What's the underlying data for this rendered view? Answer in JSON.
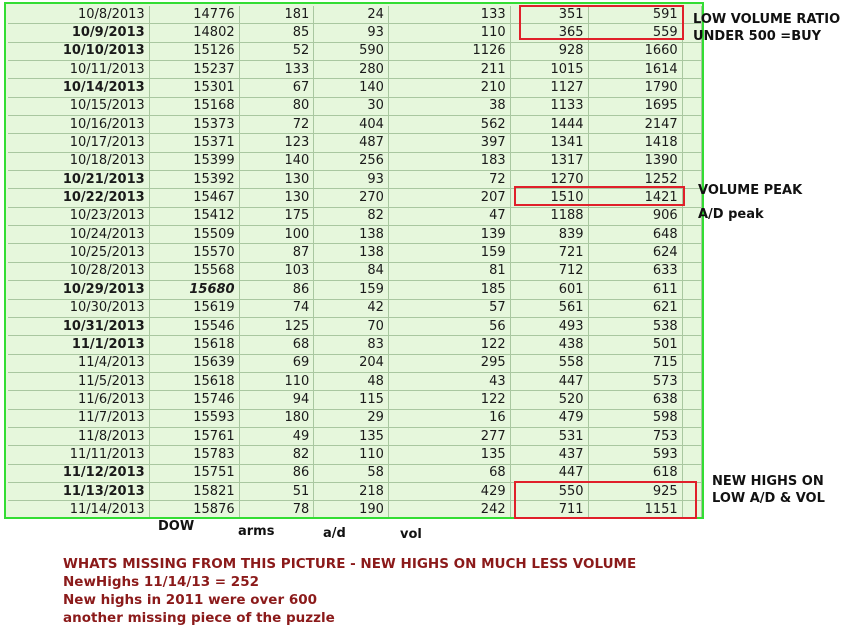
{
  "table": {
    "rows": [
      {
        "date": "10/8/2013",
        "dow": "14776",
        "arms": "181",
        "ad": "24",
        "vol": "133",
        "c6": "351",
        "c7": "591",
        "bold": false
      },
      {
        "date": "10/9/2013",
        "dow": "14802",
        "arms": "85",
        "ad": "93",
        "vol": "110",
        "c6": "365",
        "c7": "559",
        "bold": true
      },
      {
        "date": "10/10/2013",
        "dow": "15126",
        "arms": "52",
        "ad": "590",
        "vol": "1126",
        "c6": "928",
        "c7": "1660",
        "bold": true
      },
      {
        "date": "10/11/2013",
        "dow": "15237",
        "arms": "133",
        "ad": "280",
        "vol": "211",
        "c6": "1015",
        "c7": "1614",
        "bold": false
      },
      {
        "date": "10/14/2013",
        "dow": "15301",
        "arms": "67",
        "ad": "140",
        "vol": "210",
        "c6": "1127",
        "c7": "1790",
        "bold": true
      },
      {
        "date": "10/15/2013",
        "dow": "15168",
        "arms": "80",
        "ad": "30",
        "vol": "38",
        "c6": "1133",
        "c7": "1695",
        "bold": false
      },
      {
        "date": "10/16/2013",
        "dow": "15373",
        "arms": "72",
        "ad": "404",
        "vol": "562",
        "c6": "1444",
        "c7": "2147",
        "bold": false
      },
      {
        "date": "10/17/2013",
        "dow": "15371",
        "arms": "123",
        "ad": "487",
        "vol": "397",
        "c6": "1341",
        "c7": "1418",
        "bold": false
      },
      {
        "date": "10/18/2013",
        "dow": "15399",
        "arms": "140",
        "ad": "256",
        "vol": "183",
        "c6": "1317",
        "c7": "1390",
        "bold": false
      },
      {
        "date": "10/21/2013",
        "dow": "15392",
        "arms": "130",
        "ad": "93",
        "vol": "72",
        "c6": "1270",
        "c7": "1252",
        "bold": true
      },
      {
        "date": "10/22/2013",
        "dow": "15467",
        "arms": "130",
        "ad": "270",
        "vol": "207",
        "c6": "1510",
        "c7": "1421",
        "bold": true
      },
      {
        "date": "10/23/2013",
        "dow": "15412",
        "arms": "175",
        "ad": "82",
        "vol": "47",
        "c6": "1188",
        "c7": "906",
        "bold": false
      },
      {
        "date": "10/24/2013",
        "dow": "15509",
        "arms": "100",
        "ad": "138",
        "vol": "139",
        "c6": "839",
        "c7": "648",
        "bold": false
      },
      {
        "date": "10/25/2013",
        "dow": "15570",
        "arms": "87",
        "ad": "138",
        "vol": "159",
        "c6": "721",
        "c7": "624",
        "bold": false
      },
      {
        "date": "10/28/2013",
        "dow": "15568",
        "arms": "103",
        "ad": "84",
        "vol": "81",
        "c6": "712",
        "c7": "633",
        "bold": false
      },
      {
        "date": "10/29/2013",
        "dow": "15680",
        "arms": "86",
        "ad": "159",
        "vol": "185",
        "c6": "601",
        "c7": "611",
        "bold": true,
        "dow_italic": true
      },
      {
        "date": "10/30/2013",
        "dow": "15619",
        "arms": "74",
        "ad": "42",
        "vol": "57",
        "c6": "561",
        "c7": "621",
        "bold": false
      },
      {
        "date": "10/31/2013",
        "dow": "15546",
        "arms": "125",
        "ad": "70",
        "vol": "56",
        "c6": "493",
        "c7": "538",
        "bold": true
      },
      {
        "date": "11/1/2013",
        "dow": "15618",
        "arms": "68",
        "ad": "83",
        "vol": "122",
        "c6": "438",
        "c7": "501",
        "bold": true
      },
      {
        "date": "11/4/2013",
        "dow": "15639",
        "arms": "69",
        "ad": "204",
        "vol": "295",
        "c6": "558",
        "c7": "715",
        "bold": false
      },
      {
        "date": "11/5/2013",
        "dow": "15618",
        "arms": "110",
        "ad": "48",
        "vol": "43",
        "c6": "447",
        "c7": "573",
        "bold": false
      },
      {
        "date": "11/6/2013",
        "dow": "15746",
        "arms": "94",
        "ad": "115",
        "vol": "122",
        "c6": "520",
        "c7": "638",
        "bold": false
      },
      {
        "date": "11/7/2013",
        "dow": "15593",
        "arms": "180",
        "ad": "29",
        "vol": "16",
        "c6": "479",
        "c7": "598",
        "bold": false
      },
      {
        "date": "11/8/2013",
        "dow": "15761",
        "arms": "49",
        "ad": "135",
        "vol": "277",
        "c6": "531",
        "c7": "753",
        "bold": false
      },
      {
        "date": "11/11/2013",
        "dow": "15783",
        "arms": "82",
        "ad": "110",
        "vol": "135",
        "c6": "437",
        "c7": "593",
        "bold": false
      },
      {
        "date": "11/12/2013",
        "dow": "15751",
        "arms": "86",
        "ad": "58",
        "vol": "68",
        "c6": "447",
        "c7": "618",
        "bold": true
      },
      {
        "date": "11/13/2013",
        "dow": "15821",
        "arms": "51",
        "ad": "218",
        "vol": "429",
        "c6": "550",
        "c7": "925",
        "bold": true
      },
      {
        "date": "11/14/2013",
        "dow": "15876",
        "arms": "78",
        "ad": "190",
        "vol": "242",
        "c6": "711",
        "c7": "1151",
        "bold": false
      }
    ]
  },
  "annotations": {
    "low_volume_line1": "LOW VOLUME RATIO",
    "low_volume_line2": "UNDER 500 =BUY",
    "volume_peak": "VOLUME PEAK",
    "ad_peak": "A/D peak",
    "new_highs_line1": "NEW HIGHS ON",
    "new_highs_line2": "LOW A/D & VOL"
  },
  "column_labels": {
    "dow": "DOW",
    "arms": "arms",
    "ad": "a/d",
    "vol": "vol"
  },
  "footer": {
    "line1": "WHATS MISSING FROM THIS PICTURE - NEW HIGHS ON MUCH LESS VOLUME",
    "line2": "NewHighs 11/14/13 = 252",
    "line3": "New highs in 2011 were over 600",
    "line4": "another missing piece of the puzzle"
  },
  "colors": {
    "grid_background": "#e6f7dc",
    "grid_border": "#33dd33",
    "highlight_box": "#e0202a",
    "footer_text": "#8b1a1a"
  }
}
